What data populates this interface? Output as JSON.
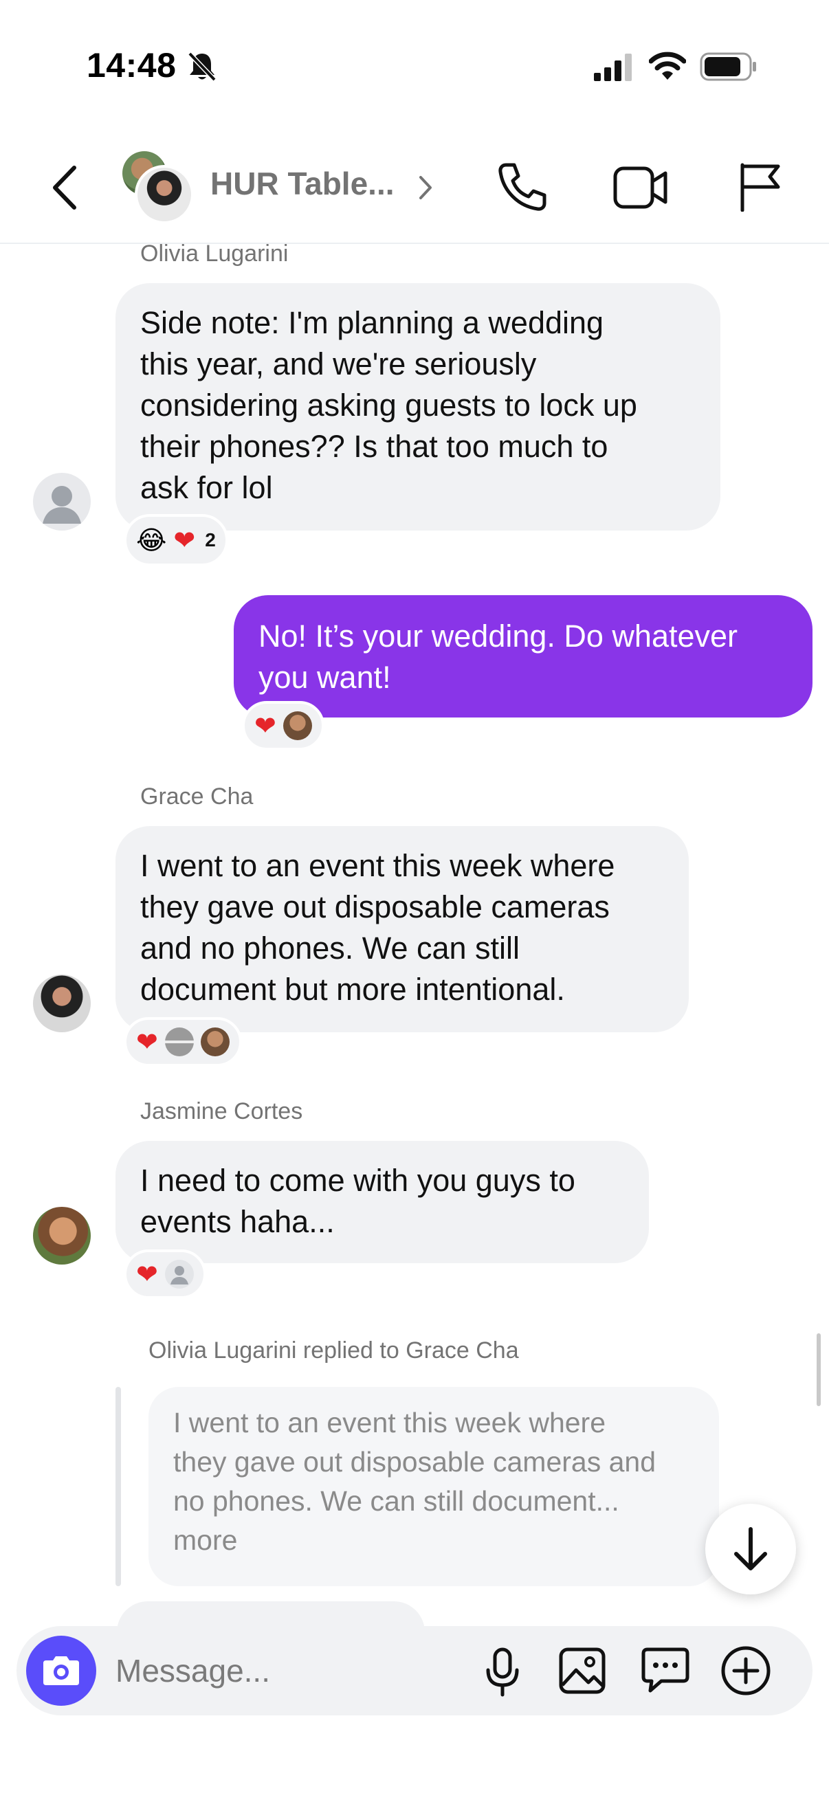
{
  "status_bar": {
    "time": "14:48"
  },
  "header": {
    "title": "HUR Table..."
  },
  "messages": [
    {
      "sender": "Olivia Lugarini",
      "text_lines": [
        "Side note: I'm planning a wedding",
        "this year, and we're seriously",
        "considering asking guests to lock up",
        "their phones?? Is that too much to",
        "ask for lol"
      ],
      "reaction_count": "2"
    },
    {
      "text_lines": [
        "No! It’s your wedding. Do whatever",
        "you want!"
      ]
    },
    {
      "sender": "Grace Cha",
      "text_lines": [
        "I went to an event this week where",
        "they gave out disposable cameras",
        "and no phones. We can still",
        "document but more intentional."
      ]
    },
    {
      "sender": "Jasmine Cortes",
      "text_lines": [
        "I need to come with you guys to",
        "events haha..."
      ]
    }
  ],
  "reply": {
    "caption": "Olivia Lugarini replied to Grace Cha",
    "quote_lines": [
      "I went to an event this week where",
      "they gave out disposable cameras and",
      "no phones. We can still document...",
      "more"
    ]
  },
  "composer": {
    "placeholder": "Message..."
  },
  "colors": {
    "accent": "#8935e8",
    "camera_button": "#5a4dfa",
    "bubble_in": "#f1f2f4"
  },
  "icons": [
    "bell-slash-icon",
    "signal-icon",
    "wifi-icon",
    "battery-icon",
    "back-chevron-icon",
    "chevron-right-icon",
    "phone-icon",
    "video-camera-icon",
    "flag-icon",
    "arrow-down-icon",
    "camera-icon",
    "microphone-icon",
    "image-icon",
    "chat-bubble-icon",
    "plus-circle-icon"
  ]
}
